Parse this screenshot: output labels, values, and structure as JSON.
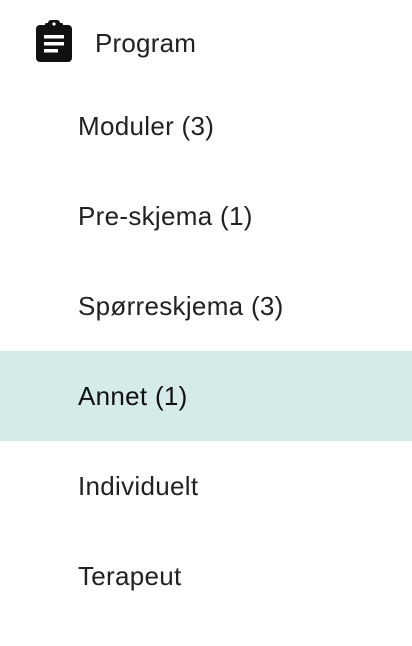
{
  "header": {
    "icon": "clipboard-icon",
    "title": "Program"
  },
  "nav": {
    "items": [
      {
        "label": "Moduler (3)",
        "selected": false
      },
      {
        "label": "Pre-skjema (1)",
        "selected": false
      },
      {
        "label": "Spørreskjema (3)",
        "selected": false
      },
      {
        "label": "Annet (1)",
        "selected": true
      },
      {
        "label": "Individuelt",
        "selected": false
      },
      {
        "label": "Terapeut",
        "selected": false
      }
    ]
  },
  "colors": {
    "selected_background": "#d5ebea",
    "text": "#212121",
    "icon": "#111111"
  }
}
